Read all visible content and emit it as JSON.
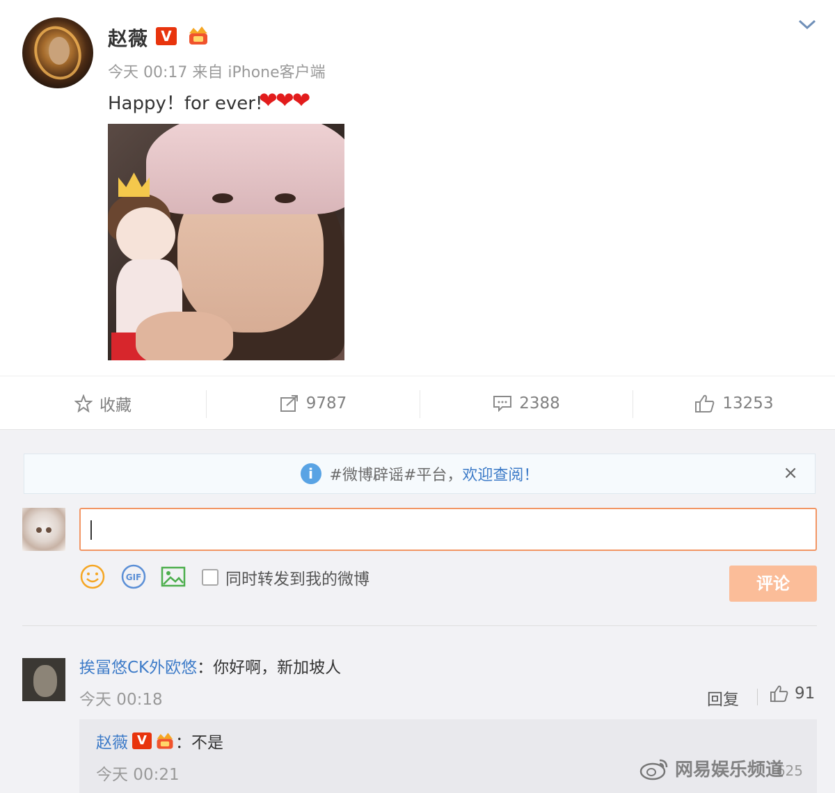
{
  "post": {
    "username": "赵薇",
    "meta": "今天 00:17 来自 iPhone客户端",
    "text": "Happy！for ever!",
    "hearts": "❤❤❤",
    "verified_label": "V"
  },
  "actions": {
    "favorite_label": "收藏",
    "repost_count": "9787",
    "comment_count": "2388",
    "like_count": "13253"
  },
  "notice": {
    "prefix": "#微博辟谣#平台，",
    "link": "欢迎查阅！",
    "info_glyph": "i",
    "close": "×"
  },
  "composer": {
    "repost_label": "同时转发到我的微博",
    "submit_label": "评论"
  },
  "comment": {
    "user": "挨冨悠CK外欧悠",
    "text": "：你好啊，新加坡人",
    "time": "今天 00:18",
    "reply_label": "回复",
    "likes": "91"
  },
  "reply": {
    "user": "赵薇",
    "text": "：不是",
    "time": "今天 00:21",
    "count": "625",
    "verified_label": "V"
  },
  "watermark": {
    "text": "网易娱乐频道"
  },
  "colors": {
    "link": "#3d7bc8",
    "accent_orange": "#f29563",
    "submit_disabled": "#fbbd99",
    "verified_red": "#e8340d",
    "heart_red": "#e21c1c"
  },
  "icons": [
    "chevron-down-icon",
    "star-icon",
    "repost-icon",
    "comment-icon",
    "thumbs-up-icon",
    "info-icon",
    "close-icon",
    "emoji-icon",
    "gif-icon",
    "image-icon",
    "weibo-logo-icon"
  ]
}
